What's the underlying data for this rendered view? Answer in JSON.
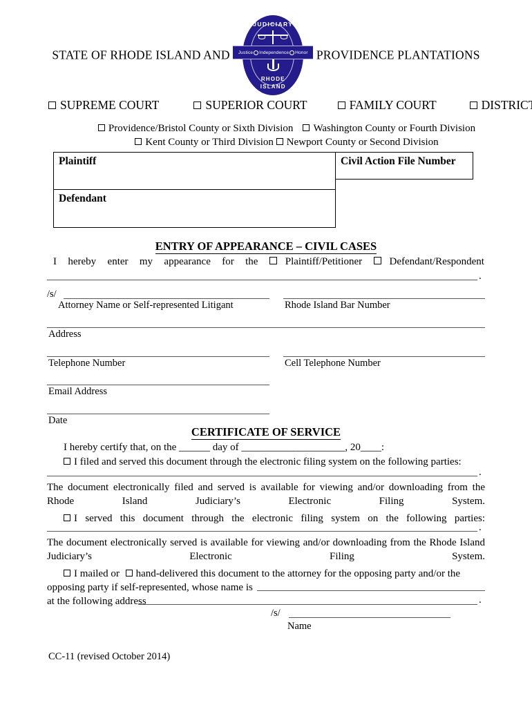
{
  "header": {
    "title_left": "STATE OF RHODE ISLAND AND",
    "title_right": "PROVIDENCE PLANTATIONS",
    "seal": {
      "top_text": "JUDICIARY",
      "bottom_text_1": "RHODE",
      "bottom_text_2": "ISLAND",
      "banner_left": "Justice",
      "banner_mid": "Independence",
      "banner_right": "Honor",
      "color": "#241C8C"
    }
  },
  "courts": [
    {
      "label": "SUPREME COURT"
    },
    {
      "label": "SUPERIOR COURT"
    },
    {
      "label": "FAMILY COURT"
    },
    {
      "label": "DISTRICT COURT"
    }
  ],
  "divisions": [
    {
      "label": "Providence/Bristol County or Sixth Division"
    },
    {
      "label": "Washington County or Fourth Division"
    },
    {
      "label": "Kent County or Third Division"
    },
    {
      "label": "Newport County or Second Division"
    }
  ],
  "caption": {
    "plaintiff_label": "Plaintiff",
    "defendant_label": "Defendant",
    "case_number_label": "Civil Action File Number"
  },
  "entry": {
    "heading": "ENTRY OF APPEARANCE – CIVIL CASES",
    "words": [
      "I",
      "hereby",
      "enter",
      "my",
      "appearance",
      "for",
      "the"
    ],
    "option_plaintiff": "Plaintiff/Petitioner",
    "option_defendant": "Defendant/Respondent",
    "trailing_period": "."
  },
  "signature_block": {
    "slash_s": "/s/",
    "attorney_label": "Attorney Name or Self-represented Litigant",
    "bar_number_label": "Rhode Island Bar Number",
    "address_label": "Address",
    "telephone_label": "Telephone Number",
    "cell_label": "Cell Telephone Number",
    "email_label": "Email Address",
    "date_label": "Date"
  },
  "certificate": {
    "heading": "CERTIFICATE OF SERVICE",
    "intro": "I hereby certify that, on the ______ day of ____________________, 20____:",
    "option1": "I filed and served this document through the electronic filing system on the following parties:",
    "option1_note": "The document electronically filed and served is available for viewing and/or downloading from the Rhode Island Judiciary’s Electronic Filing System.",
    "option2": "I served this document through the electronic filing system on the following parties:",
    "option2_note": "The document electronically served is available for viewing and/or downloading from the Rhode Island Judiciary’s Electronic Filing System.",
    "option3_a": "I mailed or",
    "option3_b": "hand-delivered this document to the attorney for the opposing party and/or the",
    "option3_c": "opposing party if self-represented, whose name is",
    "option3_d": "at the following address",
    "trailing_period": ".",
    "signature_slash": "/s/",
    "name_label": "Name"
  },
  "footer": {
    "form_id": "CC-11 (revised October 2014)"
  }
}
